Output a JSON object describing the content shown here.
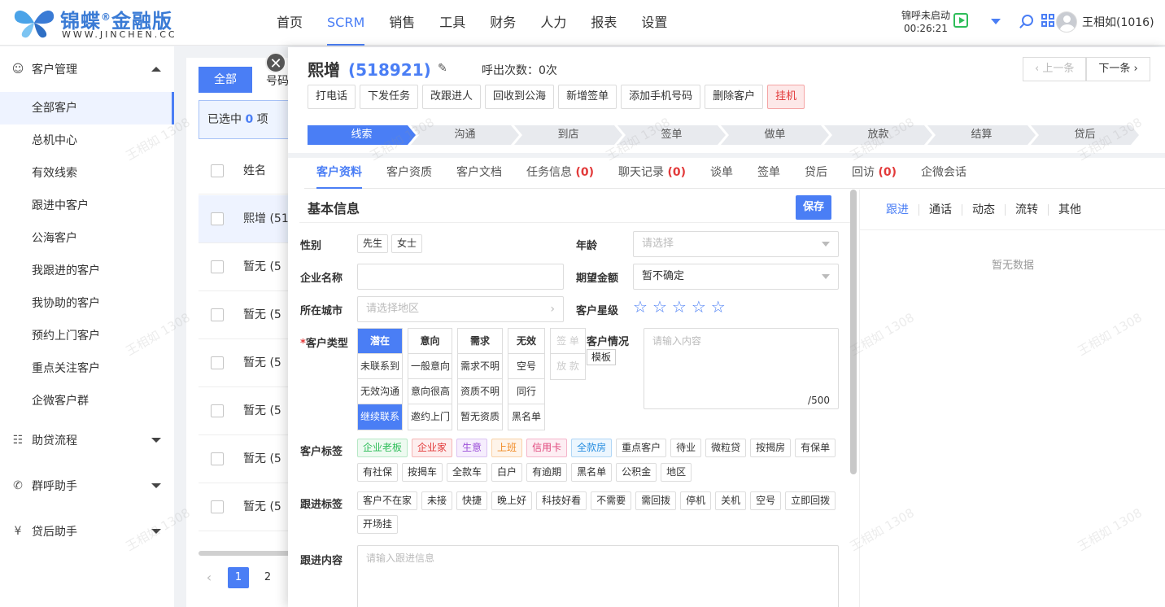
{
  "brand": {
    "name": "锦蝶",
    "suffix": "金融版",
    "reg": "®",
    "domain": "WWW.JINCHEN.CC"
  },
  "nav": [
    "首页",
    "SCRM",
    "销售",
    "工具",
    "财务",
    "人力",
    "报表",
    "设置"
  ],
  "call": {
    "status": "锦呼未启动",
    "timer": "00:26:21"
  },
  "user": {
    "name": "王相如(1016)"
  },
  "sidebar": {
    "group1": "客户管理",
    "items": [
      "全部客户",
      "总机中心",
      "有效线索",
      "跟进中客户",
      "公海客户",
      "我跟进的客户",
      "我协助的客户",
      "预约上门客户",
      "重点关注客户",
      "企微客户群"
    ],
    "group2": "助贷流程",
    "group3": "群呼助手",
    "group4": "贷后助手"
  },
  "list": {
    "tab_all": "全部",
    "tab_num": "号码",
    "selected_prefix": "已选中",
    "selected_count": "0",
    "selected_suffix": "项",
    "col_name": "姓名",
    "rows": [
      "熙增 (51",
      "暂无 (5",
      "暂无 (5",
      "暂无 (5",
      "暂无 (5",
      "暂无 (5",
      "暂无 (5"
    ],
    "pages": [
      "1",
      "2"
    ]
  },
  "detail": {
    "name": "熙增",
    "id": "(518921)",
    "call_count": "呼出次数：0次",
    "prev": "上一条",
    "next": "下一条",
    "actions": [
      "打电话",
      "下发任务",
      "改跟进人",
      "回收到公海",
      "新增签单",
      "添加手机号码",
      "删除客户"
    ],
    "hang": "挂机",
    "steps": [
      "线索",
      "沟通",
      "到店",
      "签单",
      "做单",
      "放款",
      "结算",
      "贷后"
    ],
    "tabs": [
      {
        "label": "客户资料",
        "count": ""
      },
      {
        "label": "客户资质",
        "count": ""
      },
      {
        "label": "客户文档",
        "count": ""
      },
      {
        "label": "任务信息",
        "count": "(0)"
      },
      {
        "label": "聊天记录",
        "count": "(0)"
      },
      {
        "label": "谈单",
        "count": ""
      },
      {
        "label": "签单",
        "count": ""
      },
      {
        "label": "贷后",
        "count": ""
      },
      {
        "label": "回访",
        "count": "(0)"
      },
      {
        "label": "企微会话",
        "count": ""
      }
    ]
  },
  "form": {
    "section": "基本信息",
    "save": "保存",
    "gender_label": "性别",
    "gender": [
      "先生",
      "女士"
    ],
    "age_label": "年龄",
    "age_placeholder": "请选择",
    "company_label": "企业名称",
    "amount_label": "期望金额",
    "amount_value": "暂不确定",
    "city_label": "所在城市",
    "city_placeholder": "请选择地区",
    "rating_label": "客户星级",
    "rating": 0,
    "type_label": "客户类型",
    "type_req": "*",
    "type_cols": [
      {
        "head": "潜在",
        "items": [
          "未联系到",
          "无效沟通",
          "继续联系"
        ]
      },
      {
        "head": "意向",
        "items": [
          "一般意向",
          "意向很高",
          "邀约上门"
        ]
      },
      {
        "head": "需求",
        "items": [
          "需求不明",
          "资质不明",
          "暂无资质"
        ]
      },
      {
        "head": "无效",
        "items": [
          "空号",
          "同行",
          "黑名单"
        ]
      }
    ],
    "type_disabled": [
      "签 单",
      "放 款"
    ],
    "situation_label": "客户情况",
    "template": "模板",
    "situation_placeholder": "请输入内容",
    "situation_count": "/500",
    "tags_label": "客户标签",
    "tags1": [
      "企业老板",
      "企业家",
      "生意",
      "上班",
      "信用卡",
      "全款房",
      "重点客户",
      "待业",
      "微粒贷",
      "按揭房",
      "有保单"
    ],
    "tags2": [
      "有社保",
      "按揭车",
      "全款车",
      "白户",
      "有逾期",
      "黑名单",
      "公积金",
      "地区"
    ],
    "follow_tags_label": "跟进标签",
    "follow_tags1": [
      "客户不在家",
      "未接",
      "快捷",
      "晚上好",
      "科技好看",
      "不需要",
      "需回拨",
      "停机",
      "关机",
      "空号",
      "立即回拨"
    ],
    "follow_tags2": [
      "开场挂"
    ],
    "follow_content_label": "跟进内容",
    "follow_placeholder": "请输入跟进信息"
  },
  "right": {
    "tabs": [
      "跟进",
      "通话",
      "动态",
      "流转",
      "其他"
    ],
    "empty": "暂无数据"
  },
  "watermark": "王相如 1308"
}
